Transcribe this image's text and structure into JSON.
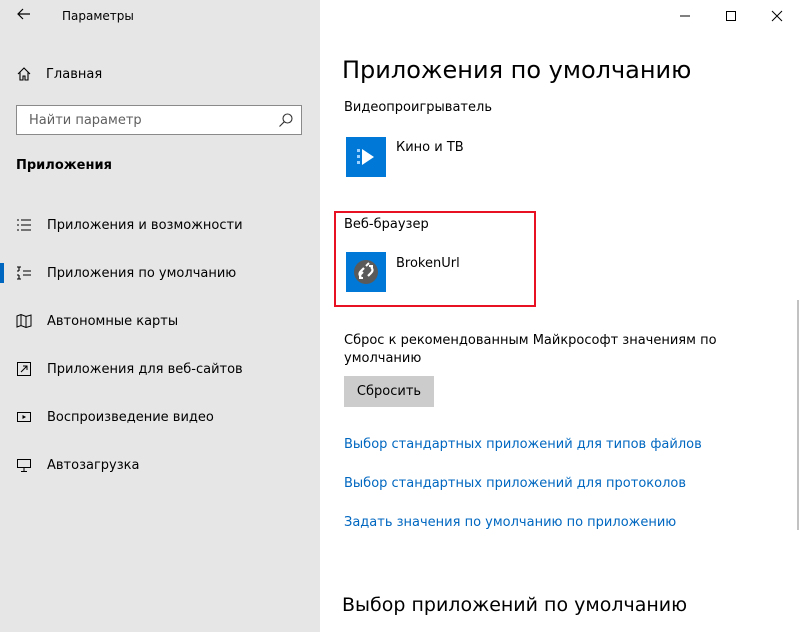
{
  "window": {
    "title": "Параметры",
    "back_icon": "back-arrow-icon",
    "controls": [
      "minimize-icon",
      "maximize-icon",
      "close-icon"
    ]
  },
  "sidebar": {
    "home_label": "Главная",
    "search_placeholder": "Найти параметр",
    "section_title": "Приложения",
    "items": [
      {
        "label": "Приложения и возможности",
        "icon": "list-icon",
        "active": false
      },
      {
        "label": "Приложения по умолчанию",
        "icon": "default-apps-icon",
        "active": true
      },
      {
        "label": "Автономные карты",
        "icon": "map-icon",
        "active": false
      },
      {
        "label": "Приложения для веб-сайтов",
        "icon": "web-app-icon",
        "active": false
      },
      {
        "label": "Воспроизведение видео",
        "icon": "video-icon",
        "active": false
      },
      {
        "label": "Автозагрузка",
        "icon": "startup-icon",
        "active": false
      }
    ]
  },
  "main": {
    "title": "Приложения по умолчанию",
    "video_player": {
      "label": "Видеопроигрыватель",
      "app_name": "Кино и ТВ",
      "icon": "film-tv-icon"
    },
    "web_browser": {
      "label": "Веб-браузер",
      "app_name": "BrokenUrl",
      "icon": "broken-link-icon"
    },
    "reset": {
      "text": "Сброс к рекомендованным Майкрософт значениям по умолчанию",
      "button_label": "Сбросить"
    },
    "links": [
      "Выбор стандартных приложений для типов файлов",
      "Выбор стандартных приложений для протоколов",
      "Задать значения по умолчанию по приложению"
    ],
    "section2_title": "Выбор приложений по умолчанию"
  },
  "colors": {
    "accent": "#0067c0",
    "sidebar_bg": "#e6e6e6",
    "tile_bg": "#0078d7",
    "highlight": "#e81123",
    "button_bg": "#cccccc"
  }
}
